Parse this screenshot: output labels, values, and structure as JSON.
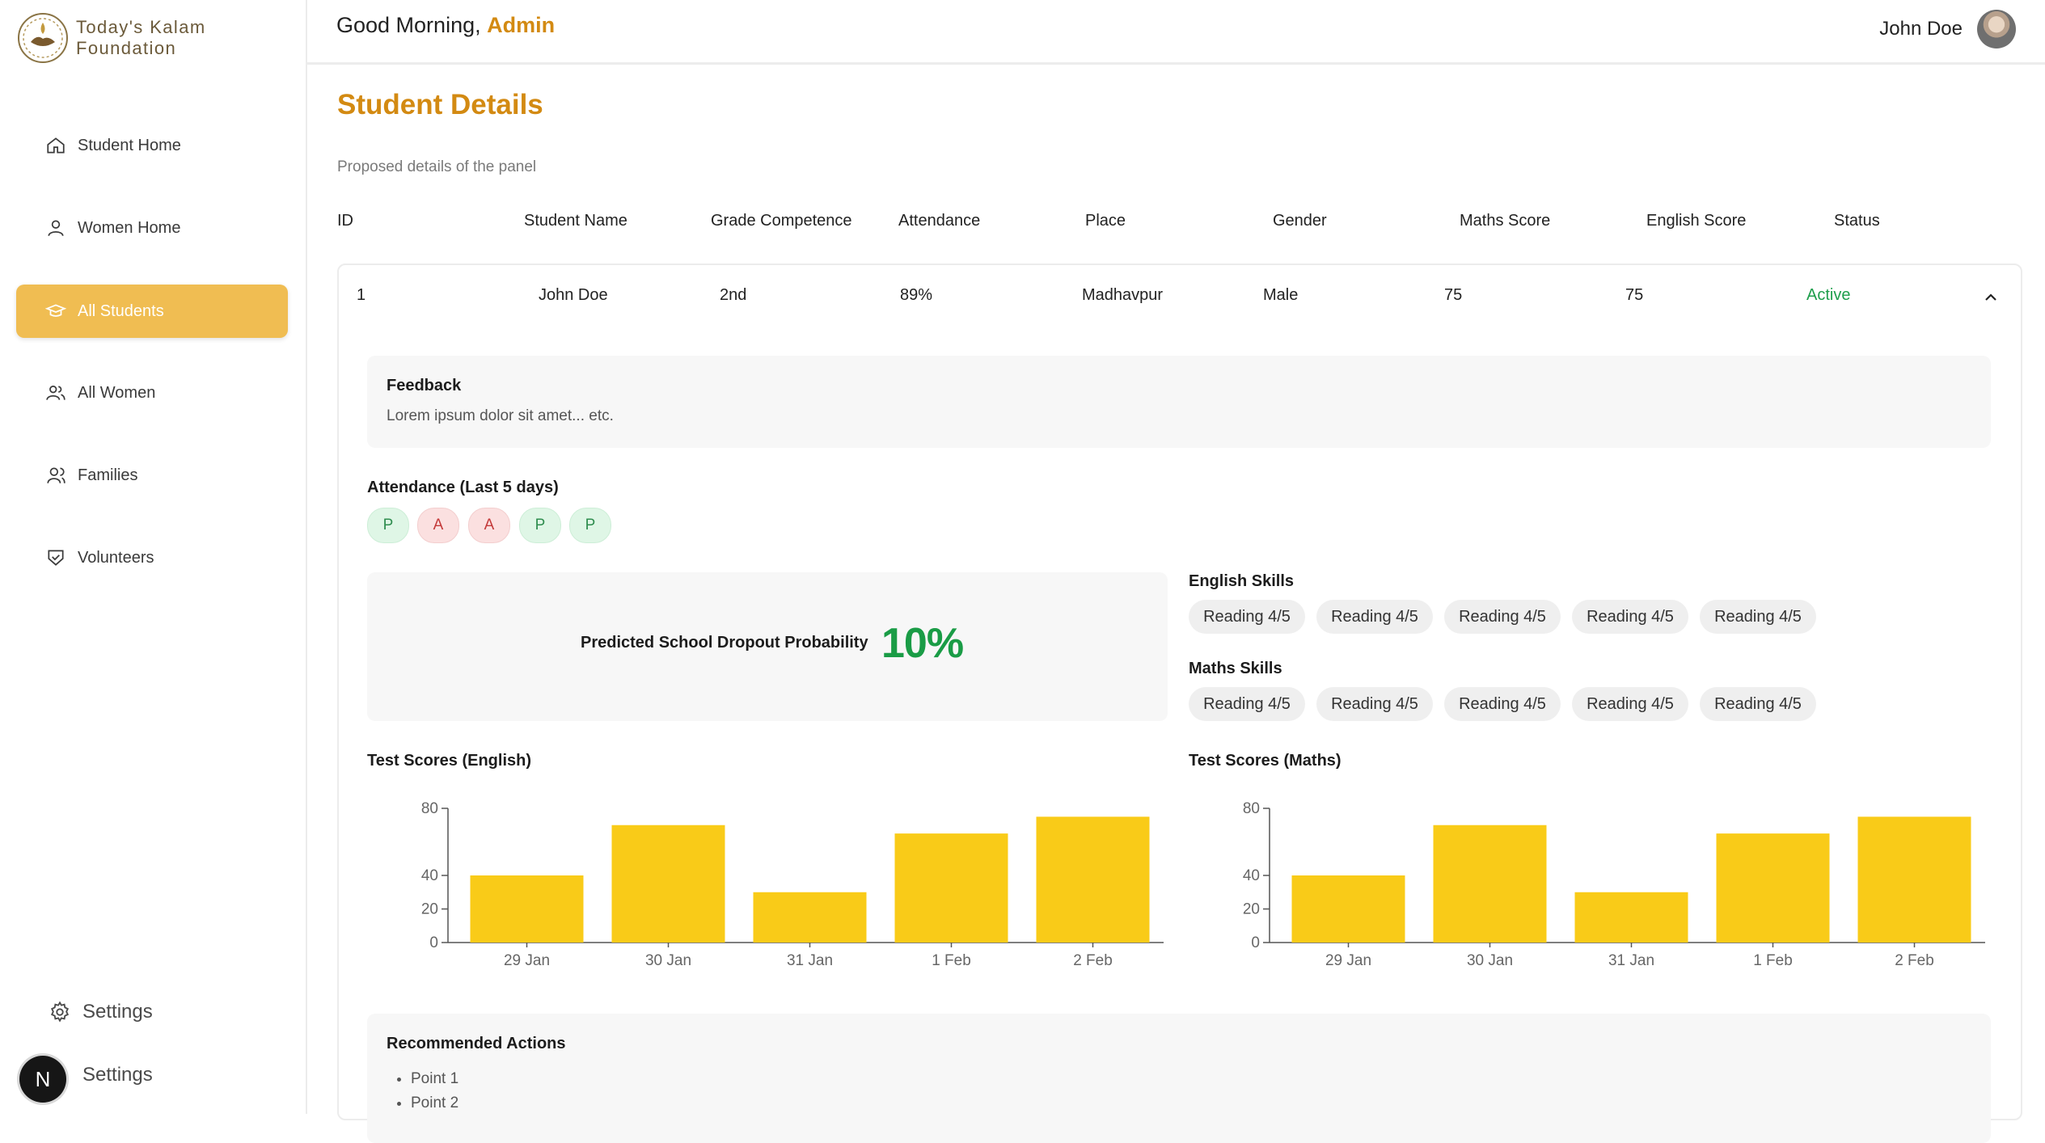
{
  "brand": {
    "line1": "Today's Kalam",
    "line2": "Foundation"
  },
  "sidebar": {
    "items": [
      {
        "label": "Student Home",
        "icon": "home-icon",
        "active": false
      },
      {
        "label": "Women Home",
        "icon": "user-icon",
        "active": false
      },
      {
        "label": "All Students",
        "icon": "graduation-cap-icon",
        "active": true
      },
      {
        "label": "All Women",
        "icon": "users-icon",
        "active": false
      },
      {
        "label": "Families",
        "icon": "family-icon",
        "active": false
      },
      {
        "label": "Volunteers",
        "icon": "handshake-icon",
        "active": false
      }
    ],
    "settings": [
      "Settings",
      "Settings"
    ],
    "badge": "N"
  },
  "header": {
    "greeting": "Good Morning, ",
    "role": "Admin",
    "user_name": "John Doe"
  },
  "page": {
    "title": "Student Details",
    "subtitle": "Proposed details of the panel"
  },
  "table": {
    "columns": [
      "ID",
      "Student Name",
      "Grade Competence",
      "Attendance",
      "Place",
      "Gender",
      "Maths Score",
      "English Score",
      "Status"
    ],
    "row": {
      "id": "1",
      "name": "John Doe",
      "grade": "2nd",
      "attendance": "89%",
      "place": "Madhavpur",
      "gender": "Male",
      "maths": "75",
      "english": "75",
      "status": "Active"
    }
  },
  "details": {
    "feedback_title": "Feedback",
    "feedback_text": "Lorem ipsum dolor sit amet... etc.",
    "attendance_title": "Attendance (Last 5 days)",
    "attendance": [
      "P",
      "A",
      "A",
      "P",
      "P"
    ],
    "dropout_label": "Predicted School Dropout Probability",
    "dropout_value": "10%",
    "english_skills_title": "English Skills",
    "english_skills": [
      "Reading 4/5",
      "Reading 4/5",
      "Reading 4/5",
      "Reading 4/5",
      "Reading 4/5"
    ],
    "maths_skills_title": "Maths Skills",
    "maths_skills": [
      "Reading 4/5",
      "Reading 4/5",
      "Reading 4/5",
      "Reading 4/5",
      "Reading 4/5"
    ],
    "recommended_title": "Recommended Actions",
    "recommended": [
      "Point 1",
      "Point 2"
    ]
  },
  "colors": {
    "accent": "#d38a12",
    "nav_active": "#f0bd52",
    "bar": "#f9cb18",
    "status_active": "#1e9e4c",
    "dropout": "#1a9c46"
  },
  "chart_data": [
    {
      "type": "bar",
      "title": "Test Scores (English)",
      "categories": [
        "29 Jan",
        "30 Jan",
        "31 Jan",
        "1 Feb",
        "2 Feb"
      ],
      "values": [
        40,
        70,
        30,
        65,
        75
      ],
      "yticks": [
        0,
        20,
        40,
        80
      ],
      "ylim": [
        0,
        80
      ],
      "grid": false
    },
    {
      "type": "bar",
      "title": "Test Scores (Maths)",
      "categories": [
        "29 Jan",
        "30 Jan",
        "31 Jan",
        "1 Feb",
        "2 Feb"
      ],
      "values": [
        40,
        70,
        30,
        65,
        75
      ],
      "yticks": [
        0,
        20,
        40,
        80
      ],
      "ylim": [
        0,
        80
      ],
      "grid": false
    }
  ]
}
